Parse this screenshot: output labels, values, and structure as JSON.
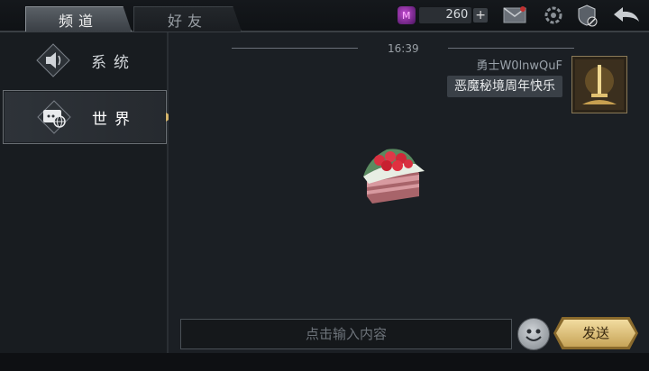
{
  "tabs": {
    "channel": "频道",
    "friends": "好友"
  },
  "currency": {
    "icon": "gem-icon",
    "value": "260",
    "plus": "+"
  },
  "channels": [
    {
      "label": "系统",
      "icon": "speaker-icon"
    },
    {
      "label": "世界",
      "icon": "world-chat-icon"
    }
  ],
  "chat": {
    "time": "16:39",
    "sender": "勇士W0lnwQuF",
    "message": "恶魔秘境周年快乐"
  },
  "input": {
    "placeholder": "点击输入内容"
  },
  "send_label": "发送",
  "colors": {
    "accent": "#d4b46a",
    "gem": "#c04ad0",
    "bg": "#1b1f24"
  }
}
